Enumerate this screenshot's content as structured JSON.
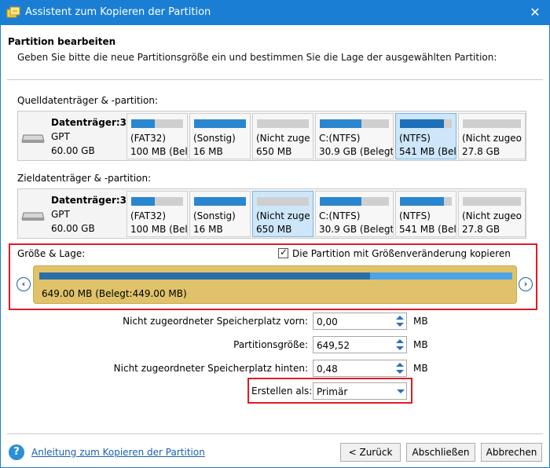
{
  "window": {
    "title": "Assistent zum Kopieren der Partition",
    "close_glyph": "✕"
  },
  "header": {
    "title": "Partition bearbeiten",
    "description": "Geben Sie bitte die neue Partitionsgröße ein und bestimmen Sie die Lage der ausgewählten Partition:"
  },
  "source": {
    "label": "Quelldatenträger & -partition:",
    "disk": {
      "name": "Datenträger:3",
      "type": "GPT",
      "size": "60.00 GB"
    },
    "partitions": [
      {
        "line1": "(FAT32)",
        "line2": "100 MB (Bel",
        "fill": 0.45,
        "selected": false
      },
      {
        "line1": "(Sonstig)",
        "line2": "16 MB",
        "fill": 1.0,
        "selected": false
      },
      {
        "line1": "(Nicht zuge",
        "line2": "650 MB",
        "fill": 0.0,
        "selected": false
      },
      {
        "line1": "C:(NTFS)",
        "line2": "30.9 GB (Belegt:",
        "fill": 0.6,
        "selected": false
      },
      {
        "line1": "(NTFS)",
        "line2": "541 MB (Bel",
        "fill": 0.85,
        "selected": true
      },
      {
        "line1": "(Nicht zugeo",
        "line2": "27.8 GB",
        "fill": 0.0,
        "selected": false
      }
    ]
  },
  "target": {
    "label": "Zieldatenträger & -partition:",
    "disk": {
      "name": "Datenträger:3",
      "type": "GPT",
      "size": "60.00 GB"
    },
    "partitions": [
      {
        "line1": "(FAT32)",
        "line2": "100 MB (Bel",
        "fill": 0.45,
        "selected": false
      },
      {
        "line1": "(Sonstig)",
        "line2": "16 MB",
        "fill": 1.0,
        "selected": false
      },
      {
        "line1": "(Nicht zuge",
        "line2": "650 MB",
        "fill": 0.0,
        "selected": true
      },
      {
        "line1": "C:(NTFS)",
        "line2": "30.9 GB (Belegt:",
        "fill": 0.6,
        "selected": false
      },
      {
        "line1": "(NTFS)",
        "line2": "541 MB (Bel",
        "fill": 0.85,
        "selected": false
      },
      {
        "line1": "(Nicht zugeo",
        "line2": "27.8 GB",
        "fill": 0.0,
        "selected": false
      }
    ]
  },
  "size_location": {
    "label": "Größe & Lage:",
    "checkbox_label": "Die Partition mit Größenveränderung kopieren",
    "checkbox_checked": true,
    "checkbox_glyph": "✓",
    "slider_text": "649.00 MB (Belegt:449.00 MB)",
    "used_fraction": 0.7,
    "left_glyph": "‹",
    "right_glyph": "›"
  },
  "fields": {
    "before": {
      "label": "Nicht zugeordneter Speicherplatz vorn:",
      "value": "0,00",
      "unit": "MB"
    },
    "size": {
      "label": "Partitionsgröße:",
      "value": "649,52",
      "unit": "MB"
    },
    "after": {
      "label": "Nicht zugeordneter Speicherplatz hinten:",
      "value": "0,48",
      "unit": "MB"
    },
    "create_as": {
      "label": "Erstellen als:",
      "value": "Primär"
    }
  },
  "footer": {
    "help_glyph": "?",
    "help_link": "Anleitung zum Kopieren der Partition",
    "back": "< Zurück",
    "finish": "Abschließen",
    "cancel": "Abbrechen"
  },
  "colors": {
    "accent": "#1a7fd4",
    "highlight_red": "#e01b24",
    "slider": "#dfc26a",
    "used": "#2a6fa8"
  }
}
